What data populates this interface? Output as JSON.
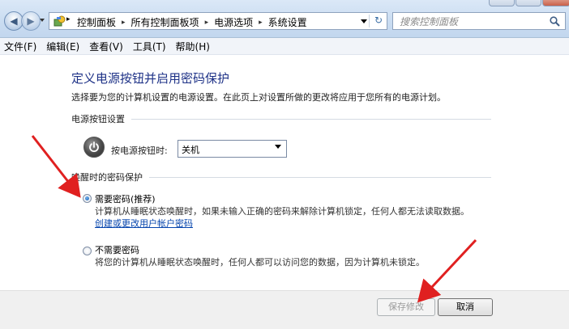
{
  "addressbar": {
    "breadcrumbs": [
      "控制面板",
      "所有控制面板项",
      "电源选项",
      "系统设置"
    ],
    "search_placeholder": "搜索控制面板"
  },
  "menubar": {
    "items": [
      "文件(F)",
      "编辑(E)",
      "查看(V)",
      "工具(T)",
      "帮助(H)"
    ]
  },
  "page": {
    "title": "定义电源按钮并启用密码保护",
    "description": "选择要为您的计算机设置的电源设置。在此页上对设置所做的更改将应用于您所有的电源计划。"
  },
  "power_button_section": {
    "header": "电源按钮设置",
    "label": "按电源按钮时:",
    "selected_value": "关机"
  },
  "password_section": {
    "header": "唤醒时的密码保护",
    "options": [
      {
        "title": "需要密码(推荐)",
        "desc": "计算机从睡眠状态唤醒时，如果未输入正确的密码来解除计算机锁定，任何人都无法读取数据。",
        "link": "创建或更改用户帐户密码",
        "checked": true
      },
      {
        "title": "不需要密码",
        "desc": "将您的计算机从睡眠状态唤醒时，任何人都可以访问您的数据，因为计算机未锁定。",
        "checked": false
      }
    ]
  },
  "footer": {
    "save_label": "保存修改",
    "cancel_label": "取消"
  },
  "colors": {
    "title": "#1e3287",
    "link": "#0645ad",
    "annotation_arrow": "#e02020"
  }
}
